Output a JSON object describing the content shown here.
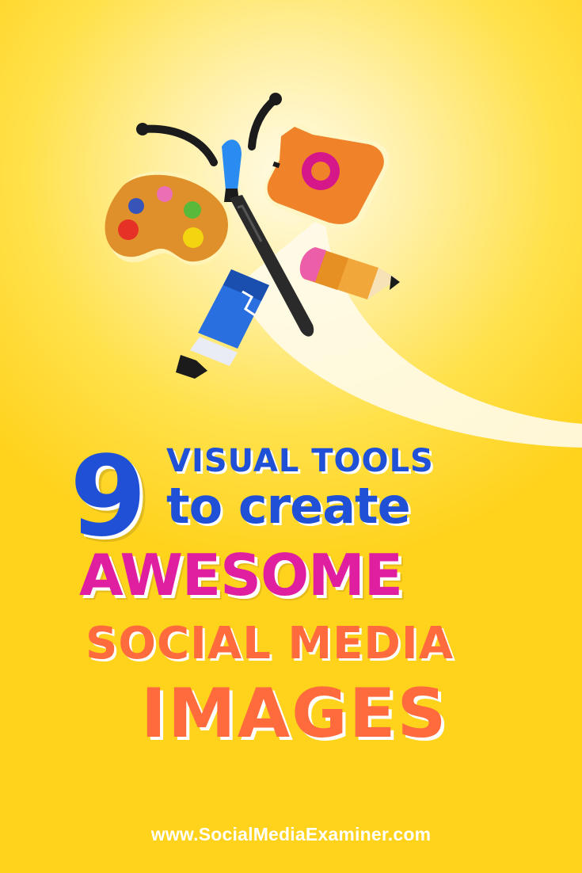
{
  "title": {
    "number": "9",
    "line1": "VISUAL TOOLS",
    "line2": "to create",
    "line3": "AWESOME",
    "line4": "SOCIAL MEDIA",
    "line5": "IMAGES"
  },
  "footer": {
    "url": "www.SocialMediaExaminer.com"
  },
  "colors": {
    "background": "#ffd21c",
    "blue": "#1f50d6",
    "magenta": "#e01ea0",
    "orange": "#ff6b3d"
  },
  "icons": [
    "palette-icon",
    "paintbrush-icon",
    "camera-icon",
    "pencil-icon",
    "paint-tube-icon"
  ]
}
